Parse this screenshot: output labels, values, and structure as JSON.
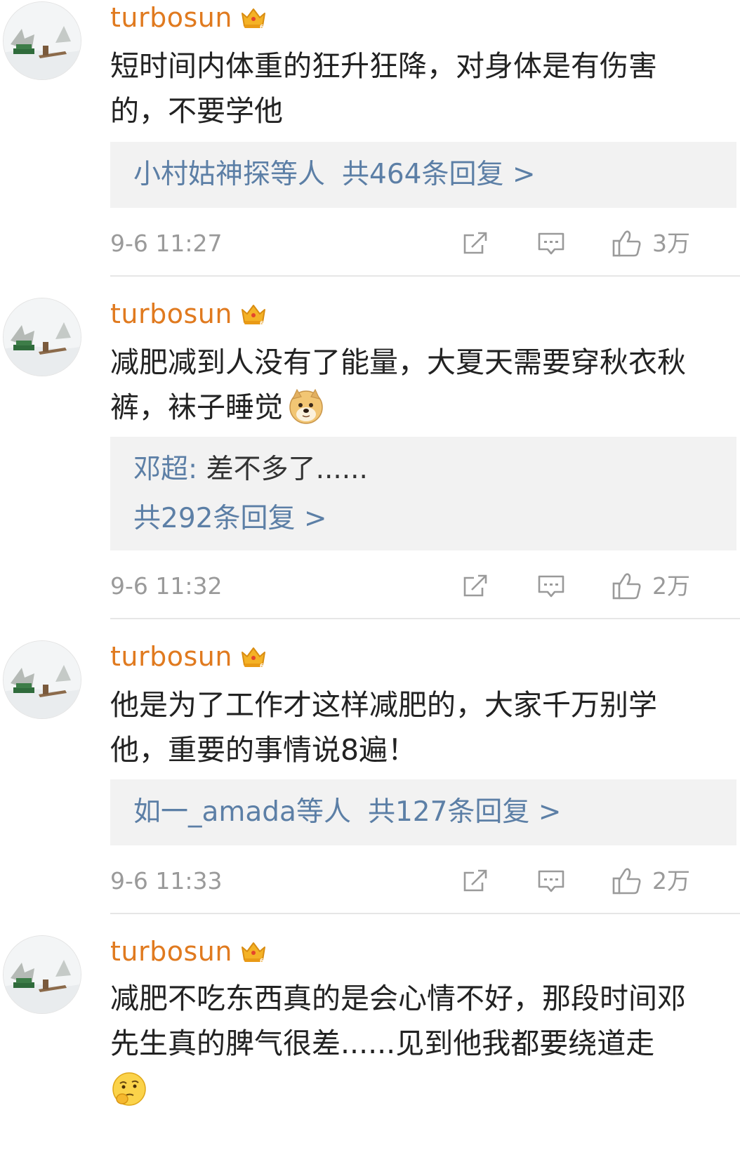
{
  "comments": [
    {
      "username": "turbosun",
      "content": "短时间内体重的狂升狂降，对身体是有伤害的，不要学他",
      "reply_lines": [
        {
          "prefix": "小村姑神探等人",
          "count": "共464条回复 >"
        }
      ],
      "time": "9-6 11:27",
      "likes": "3万"
    },
    {
      "username": "turbosun",
      "content": "减肥减到人没有了能量，大夏天需要穿秋衣秋裤，袜子睡觉",
      "emoji": "doge-emoji",
      "reply_lines": [
        {
          "user": "邓超",
          "text": "差不多了......"
        },
        {
          "count": "共292条回复 >"
        }
      ],
      "time": "9-6 11:32",
      "likes": "2万"
    },
    {
      "username": "turbosun",
      "content": "他是为了工作才这样减肥的，大家千万别学他，重要的事情说8遍！",
      "reply_lines": [
        {
          "prefix": "如一_amada等人",
          "count": "共127条回复 >"
        }
      ],
      "time": "9-6 11:33",
      "likes": "2万"
    },
    {
      "username": "turbosun",
      "content": "减肥不吃东西真的是会心情不好，那段时间邓先生真的脾气很差......见到他我都要绕道走",
      "emoji": "thinking-emoji"
    }
  ],
  "icons": {
    "share": "share-icon",
    "comment": "comment-icon",
    "like": "like-thumb-icon",
    "vip": "crown-vip-icon"
  },
  "colors": {
    "username": "#e07a1f",
    "link": "#5c7fa6",
    "meta": "#9a9a9a",
    "reply_bg": "#f2f2f2"
  }
}
